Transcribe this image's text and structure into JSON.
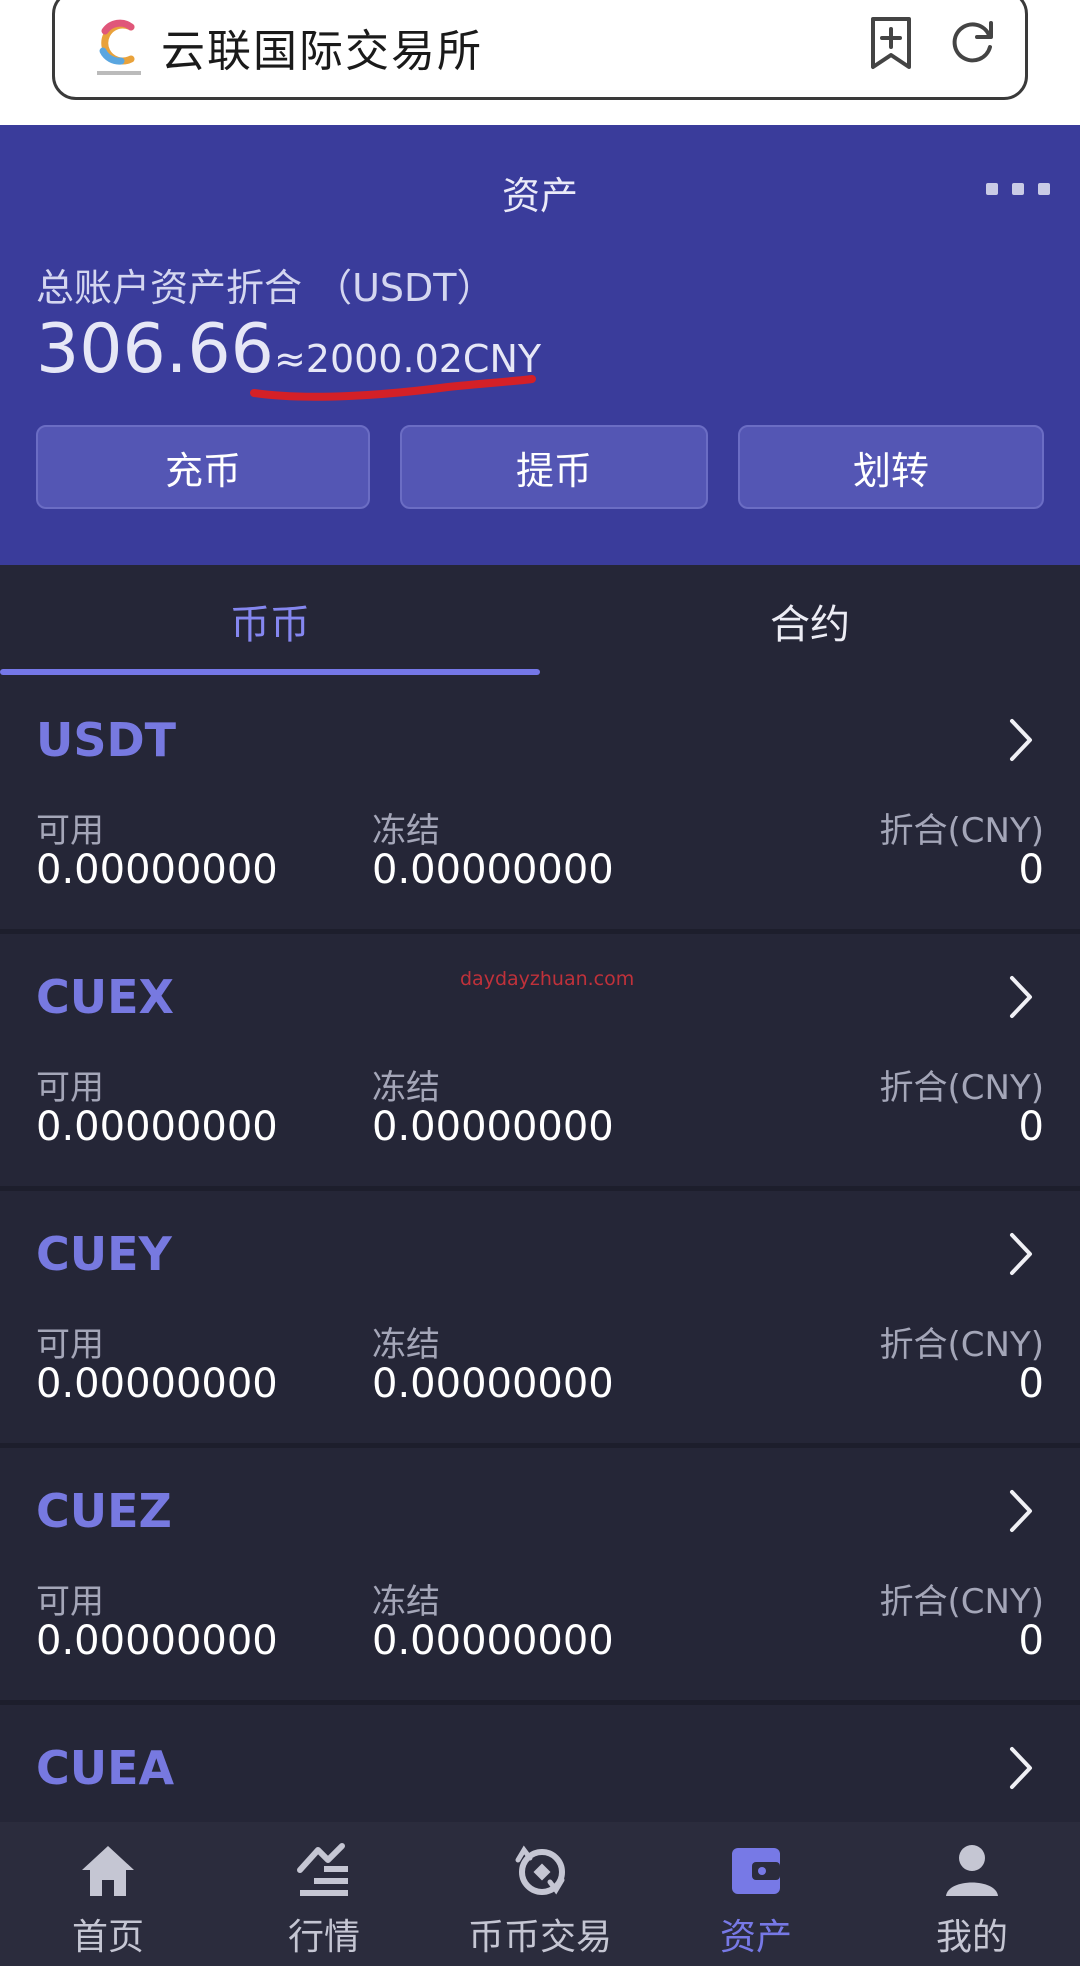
{
  "browser": {
    "site_title": "云联国际交易所"
  },
  "header": {
    "title": "资产",
    "total_label": "总账户资产折合 （USDT）",
    "total_value": "306.66",
    "total_cny": "≈2000.02CNY",
    "buttons": {
      "deposit": "充币",
      "withdraw": "提币",
      "transfer": "划转"
    }
  },
  "tabs": [
    {
      "label": "币币",
      "active": true
    },
    {
      "label": "合约",
      "active": false
    }
  ],
  "coins": [
    {
      "name": "USDT",
      "available_label": "可用",
      "available": "0.00000000",
      "frozen_label": "冻结",
      "frozen": "0.00000000",
      "cny_label": "折合(CNY)",
      "cny": "0"
    },
    {
      "name": "CUEX",
      "available_label": "可用",
      "available": "0.00000000",
      "frozen_label": "冻结",
      "frozen": "0.00000000",
      "cny_label": "折合(CNY)",
      "cny": "0"
    },
    {
      "name": "CUEY",
      "available_label": "可用",
      "available": "0.00000000",
      "frozen_label": "冻结",
      "frozen": "0.00000000",
      "cny_label": "折合(CNY)",
      "cny": "0"
    },
    {
      "name": "CUEZ",
      "available_label": "可用",
      "available": "0.00000000",
      "frozen_label": "冻结",
      "frozen": "0.00000000",
      "cny_label": "折合(CNY)",
      "cny": "0"
    },
    {
      "name": "CUEA"
    }
  ],
  "watermark": "daydayzhuan.com",
  "nav": [
    {
      "label": "首页",
      "icon": "home-icon",
      "active": false
    },
    {
      "label": "行情",
      "icon": "market-icon",
      "active": false
    },
    {
      "label": "币币交易",
      "icon": "trade-icon",
      "active": false
    },
    {
      "label": "资产",
      "icon": "wallet-icon",
      "active": true
    },
    {
      "label": "我的",
      "icon": "user-icon",
      "active": false
    }
  ],
  "colors": {
    "header_bg": "#3a3c9b",
    "page_bg": "#252637",
    "accent": "#7779e0",
    "underline_red": "#d42027"
  }
}
